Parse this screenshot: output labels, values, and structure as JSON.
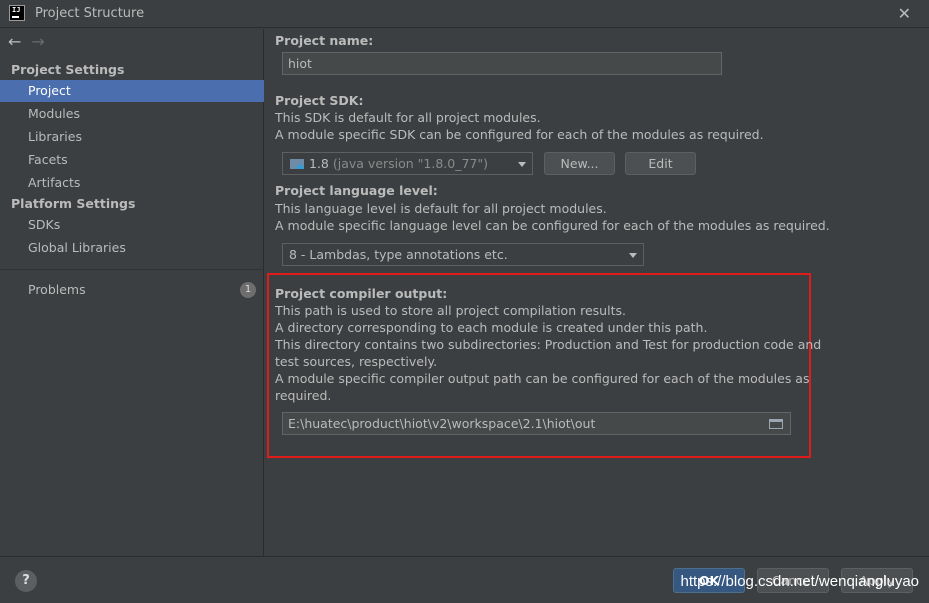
{
  "window": {
    "title": "Project Structure",
    "app_icon_text": "IJ"
  },
  "sidebar": {
    "sections": [
      {
        "heading": "Project Settings",
        "items": [
          "Project",
          "Modules",
          "Libraries",
          "Facets",
          "Artifacts"
        ]
      },
      {
        "heading": "Platform Settings",
        "items": [
          "SDKs",
          "Global Libraries"
        ]
      }
    ],
    "problems": {
      "label": "Problems",
      "count": "1"
    },
    "selected_item": "Project"
  },
  "project": {
    "name_label": "Project name:",
    "name_value": "hiot",
    "sdk_label": "Project SDK:",
    "sdk_desc1": "This SDK is default for all project modules.",
    "sdk_desc2": "A module specific SDK can be configured for each of the modules as required.",
    "sdk_name": "1.8",
    "sdk_version": "(java version \"1.8.0_77\")",
    "sdk_new_button": "New...",
    "sdk_edit_button": "Edit",
    "lang_label": "Project language level:",
    "lang_desc1": "This language level is default for all project modules.",
    "lang_desc2": "A module specific language level can be configured for each of the modules as required.",
    "lang_value": "8 - Lambdas, type annotations etc.",
    "output_label": "Project compiler output:",
    "output_desc1": "This path is used to store all project compilation results.",
    "output_desc2": "A directory corresponding to each module is created under this path.",
    "output_desc3": "This directory contains two subdirectories: Production and Test for production code and",
    "output_desc4": "test sources, respectively.",
    "output_desc5": "A module specific compiler output path can be configured for each of the modules as",
    "output_desc6": "required.",
    "output_path": "E:\\huatec\\product\\hiot\\v2\\workspace\\2.1\\hiot\\out"
  },
  "footer": {
    "help": "?",
    "ok": "OK",
    "cancel": "Cancel",
    "apply": "Apply"
  },
  "watermark": "https://blog.csdn.net/wenqiangluyao",
  "colors": {
    "background": "#3c3f41",
    "selection": "#4b6eaf",
    "highlight_box": "#e01b1b",
    "primary_button": "#365880"
  }
}
